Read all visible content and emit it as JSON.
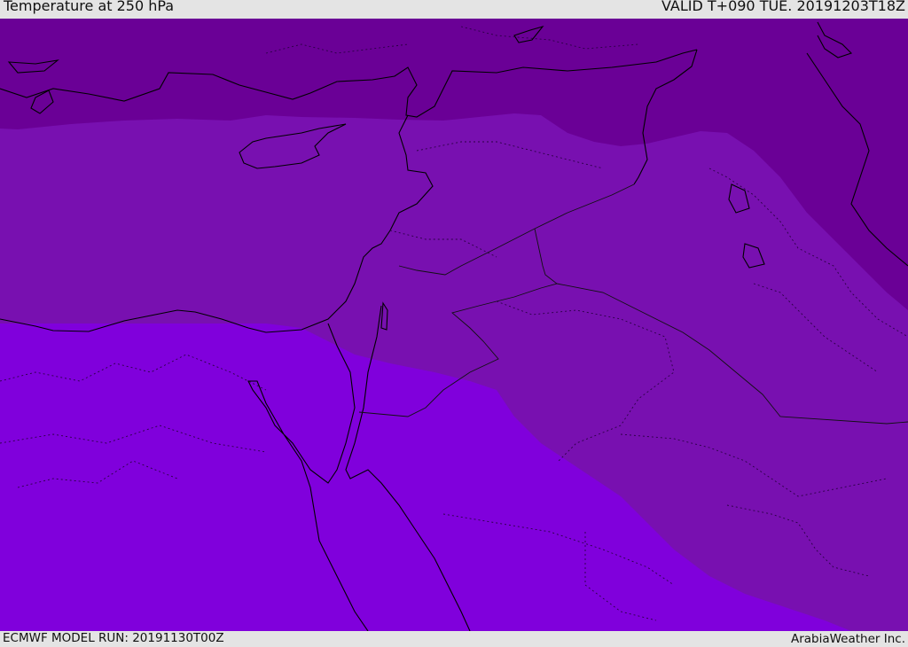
{
  "header": {
    "title": "Temperature at 250 hPa",
    "valid_time": "VALID T+090 TUE. 20191203T18Z"
  },
  "footer": {
    "model_run": "ECMWF MODEL RUN: 20191130T00Z",
    "credit": "ArabiaWeather Inc."
  },
  "map": {
    "fill_bands": [
      {
        "band": "coldest",
        "color": "#6a0096"
      },
      {
        "band": "middle",
        "color": "#7810b0"
      },
      {
        "band": "warmest",
        "color": "#8000dc"
      }
    ],
    "coastline_color": "#000000",
    "border_color": "#1a0033"
  }
}
